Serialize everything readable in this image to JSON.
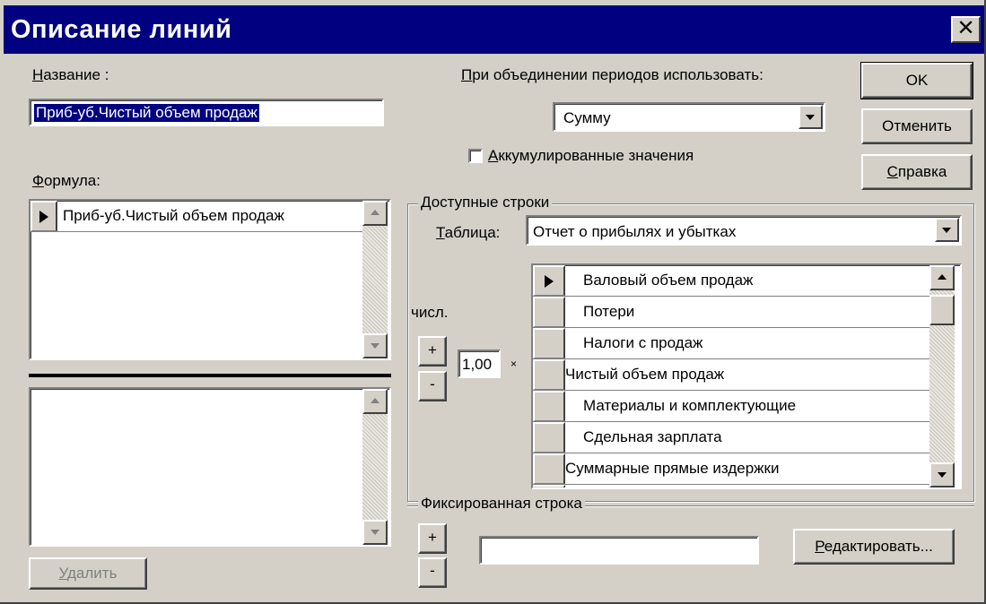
{
  "window": {
    "title": "Описание линий",
    "close_glyph": "✕"
  },
  "name_field": {
    "label": "Название :",
    "label_hotkey": "Н",
    "label_rest": "азвание :",
    "value": "Приб-уб.Чистый объем продаж"
  },
  "merge": {
    "label_hotkey": "П",
    "label_rest": "ри объединении периодов использовать:",
    "selected": "Сумму"
  },
  "accumulated": {
    "label_hotkey": "А",
    "label_rest": "ккумулированные значения",
    "checked": false
  },
  "buttons": {
    "ok": "OK",
    "cancel": "Отменить",
    "help_hotkey": "С",
    "help_rest": "правка",
    "delete_hotkey": "У",
    "delete_rest": "далить",
    "edit_hotkey": "Р",
    "edit_rest": "едактировать..."
  },
  "formula": {
    "label_hotkey": "Ф",
    "label_rest": "ормула:",
    "rows": [
      "Приб-уб.Чистый объем продаж"
    ]
  },
  "available_rows": {
    "group_title": "Доступные строки",
    "table_label_hotkey": "Т",
    "table_label_rest": "аблица:",
    "table_selected": "Отчет о прибылях и убытках",
    "coef_label": "числ.",
    "coef_value": "1,00",
    "times": "×",
    "plus": "+",
    "minus": "-",
    "rows": [
      {
        "text": "Валовый объем продаж",
        "indent": true,
        "current": true
      },
      {
        "text": "Потери",
        "indent": true,
        "current": false
      },
      {
        "text": "Налоги с продаж",
        "indent": true,
        "current": false
      },
      {
        "text": "Чистый объем продаж",
        "indent": false,
        "current": false
      },
      {
        "text": "Материалы и комплектующие",
        "indent": true,
        "current": false
      },
      {
        "text": "Сдельная зарплата",
        "indent": true,
        "current": false
      },
      {
        "text": "Суммарные прямые издержки",
        "indent": false,
        "current": false
      }
    ]
  },
  "fixed_row": {
    "group_title": "Фиксированная строка",
    "plus": "+",
    "minus": "-",
    "value": ""
  }
}
